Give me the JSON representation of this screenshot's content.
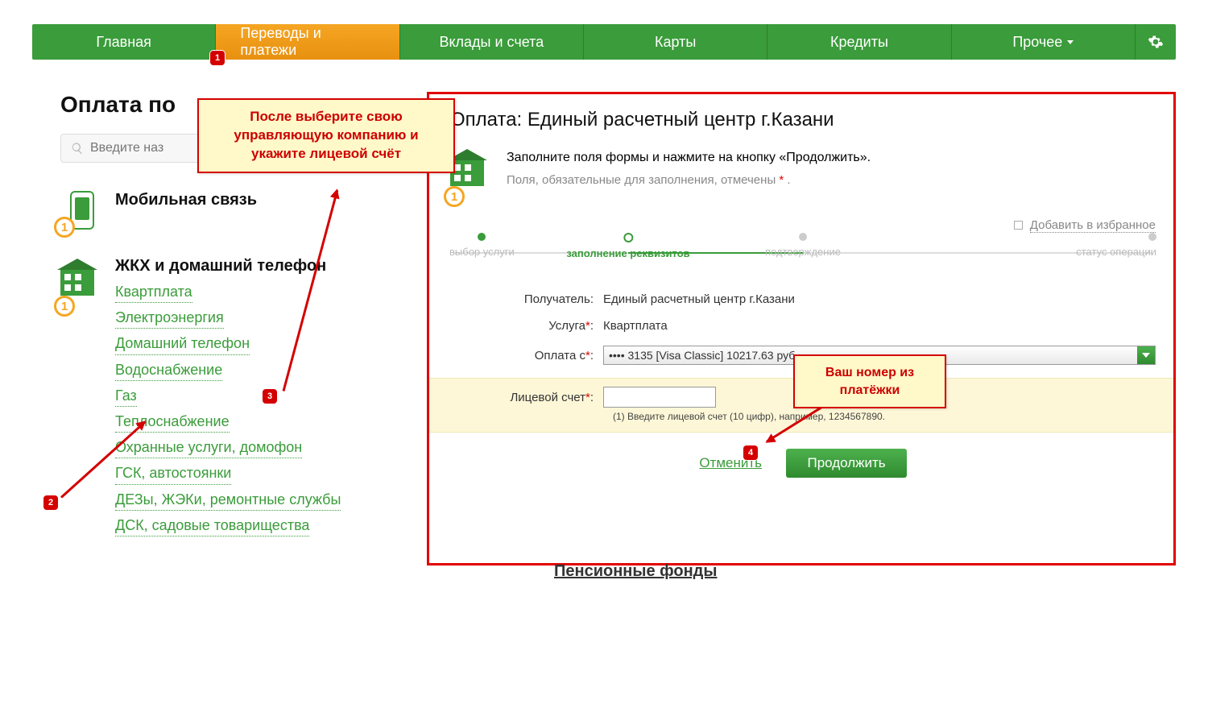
{
  "nav": {
    "items": [
      "Главная",
      "Переводы и платежи",
      "Вклады и счета",
      "Карты",
      "Кредиты",
      "Прочее"
    ],
    "active_index": 1
  },
  "left": {
    "page_title": "Оплата по",
    "search_placeholder": "Введите наз",
    "cat_mobile": {
      "title": "Мобильная связь",
      "ring": "1"
    },
    "cat_utilities": {
      "title": "ЖКХ и домашний телефон",
      "ring": "1",
      "links": [
        "Квартплата",
        "Электроэнергия",
        "Домашний телефон",
        "Водоснабжение",
        "Газ",
        "Теплоснабжение",
        "Охранные услуги, домофон",
        "ГСК, автостоянки",
        "ДЕЗы, ЖЭКи, ремонтные службы",
        "ДСК, садовые товарищества"
      ]
    },
    "partial_below": "Пенсионные фонды"
  },
  "right": {
    "title": "Оплата: Единый расчетный центр г.Казани",
    "instruction": "Заполните поля формы и нажмите на кнопку «Продолжить».",
    "required_note_prefix": "Поля, обязательные для заполнения, отмечены ",
    "required_note_suffix": " .",
    "favorite": "Добавить в избранное",
    "wizard": [
      "выбор услуги",
      "заполнение реквизитов",
      "подтверждение",
      "статус операции"
    ],
    "active_step": 1,
    "form": {
      "recipient_label": "Получатель:",
      "recipient_value": "Единый расчетный центр г.Казани",
      "service_label": "Услуга",
      "service_value": "Квартплата",
      "payfrom_label": "Оплата с",
      "payfrom_value": "•••• 3135 [Visa Classic] 10217.63 руб.",
      "account_label": "Лицевой счет",
      "account_hint": "(1) Введите лицевой счет (10 цифр), например, 1234567890."
    },
    "actions": {
      "cancel": "Отменить",
      "continue": "Продолжить"
    },
    "house_ring": "1"
  },
  "callouts": {
    "c1": "После выберите свою управляющую компанию и укажите лицевой счёт",
    "c2": "Ваш номер из платёжки"
  },
  "badges": {
    "b1": "1",
    "b2": "2",
    "b3": "3",
    "b4": "4"
  }
}
